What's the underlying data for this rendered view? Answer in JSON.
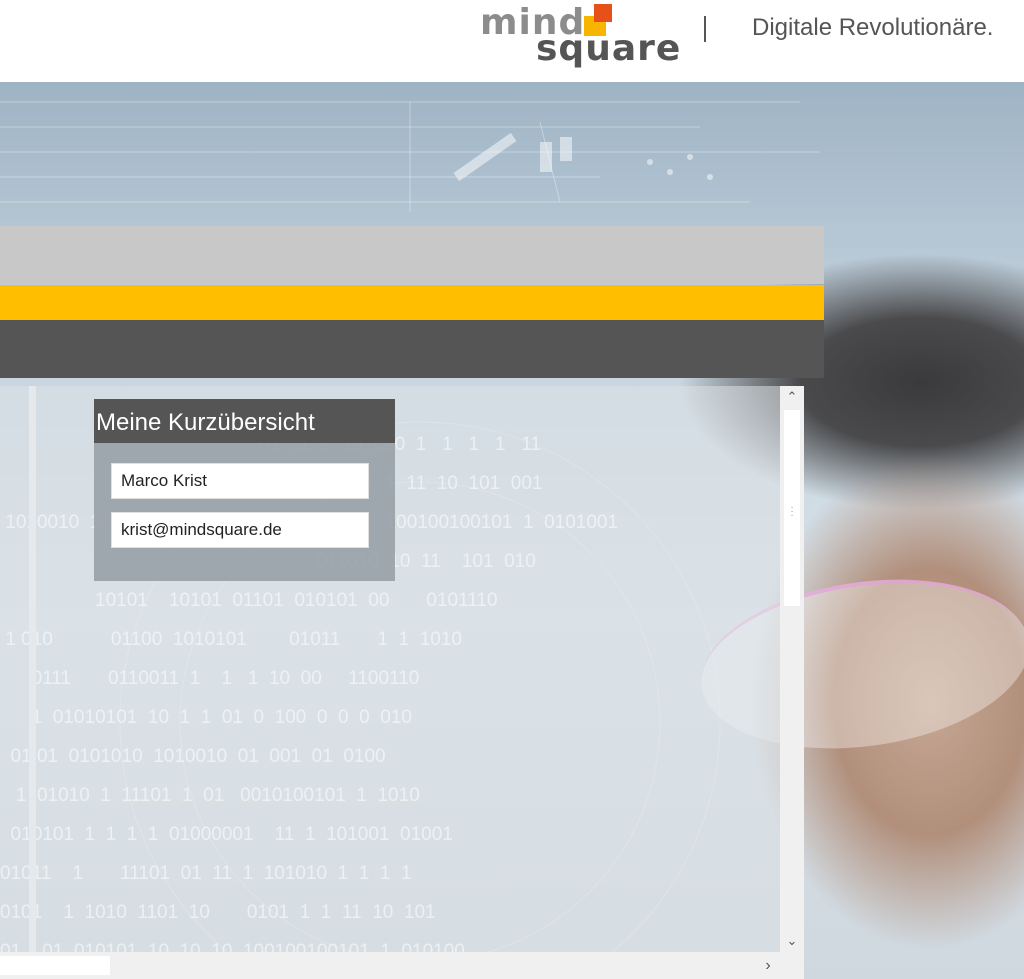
{
  "header": {
    "logo_word_1": "mind",
    "logo_word_2": "square",
    "tagline": "Digitale Revolutionäre."
  },
  "colors": {
    "accent_yellow": "#ffbf00",
    "bar_dark": "#555555",
    "bar_light": "#c8c8c8",
    "logo_orange": "#e8501a",
    "logo_yellow": "#f7b500"
  },
  "card": {
    "title": "Meine Kurzübersicht",
    "name": "Marco Krist",
    "email": "krist@mindsquare.de"
  },
  "scroll": {
    "up_icon": "chevron-up-icon",
    "down_icon": "chevron-down-icon",
    "right_icon": "chevron-right-icon"
  }
}
